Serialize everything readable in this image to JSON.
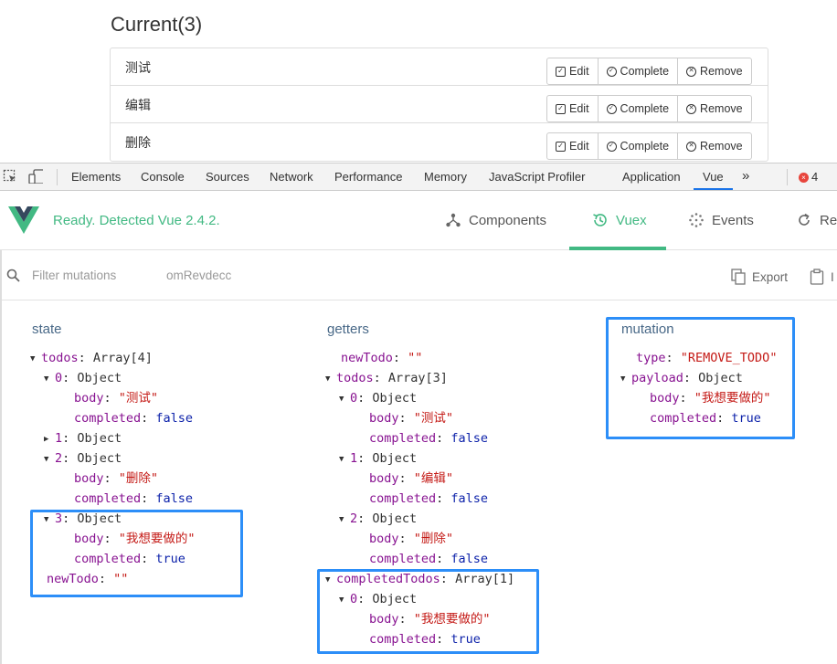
{
  "app": {
    "heading": "Current(3)",
    "todos": [
      {
        "text": "测试",
        "edit": "Edit",
        "complete": "Complete",
        "remove": "Remove"
      },
      {
        "text": "编辑",
        "edit": "Edit",
        "complete": "Complete",
        "remove": "Remove"
      },
      {
        "text": "删除",
        "edit": "Edit",
        "complete": "Complete",
        "remove": "Remove"
      }
    ]
  },
  "devtools": {
    "tabs": [
      "Elements",
      "Console",
      "Sources",
      "Network",
      "Performance",
      "Memory",
      "JavaScript Profiler",
      "Application",
      "Vue"
    ],
    "active_tab": "Vue",
    "more": "»",
    "error_count": "4",
    "error_mark": "×"
  },
  "vue": {
    "status": "Ready. Detected Vue 2.4.2.",
    "nav": {
      "components": "Components",
      "vuex": "Vuex",
      "events": "Events",
      "refresh": "Ref"
    },
    "active_nav": "Vuex",
    "filter_placeholder": "Filter mutations",
    "filter_ghost": "omRevdecc",
    "export": "Export",
    "import": "I"
  },
  "state": {
    "title": "state",
    "lines": [
      {
        "k": "todos",
        "v": "Array[4]"
      },
      {
        "k": "0",
        "v": "Object"
      },
      {
        "k": "body",
        "v": "\"测试\""
      },
      {
        "k": "completed",
        "v": "false"
      },
      {
        "k": "1",
        "v": "Object"
      },
      {
        "k": "2",
        "v": "Object"
      },
      {
        "k": "body",
        "v": "\"删除\""
      },
      {
        "k": "completed",
        "v": "false"
      },
      {
        "k": "3",
        "v": "Object"
      },
      {
        "k": "body",
        "v": "\"我想要做的\""
      },
      {
        "k": "completed",
        "v": "true"
      },
      {
        "k": "newTodo",
        "v": "\"\""
      }
    ]
  },
  "getters": {
    "title": "getters",
    "lines": [
      {
        "k": "newTodo",
        "v": "\"\""
      },
      {
        "k": "todos",
        "v": "Array[3]"
      },
      {
        "k": "0",
        "v": "Object"
      },
      {
        "k": "body",
        "v": "\"测试\""
      },
      {
        "k": "completed",
        "v": "false"
      },
      {
        "k": "1",
        "v": "Object"
      },
      {
        "k": "body",
        "v": "\"编辑\""
      },
      {
        "k": "completed",
        "v": "false"
      },
      {
        "k": "2",
        "v": "Object"
      },
      {
        "k": "body",
        "v": "\"删除\""
      },
      {
        "k": "completed",
        "v": "false"
      },
      {
        "k": "completedTodos",
        "v": "Array[1]"
      },
      {
        "k": "0",
        "v": "Object"
      },
      {
        "k": "body",
        "v": "\"我想要做的\""
      },
      {
        "k": "completed",
        "v": "true"
      }
    ]
  },
  "mutation": {
    "title": "mutation",
    "lines": [
      {
        "k": "type",
        "v": "\"REMOVE_TODO\""
      },
      {
        "k": "payload",
        "v": "Object"
      },
      {
        "k": "body",
        "v": "\"我想要做的\""
      },
      {
        "k": "completed",
        "v": "true"
      }
    ]
  },
  "colors": {
    "vue_green": "#42b983",
    "highlight": "#2c8ef8",
    "key": "#881391",
    "string": "#c41a16",
    "bool": "#0d22aa"
  }
}
